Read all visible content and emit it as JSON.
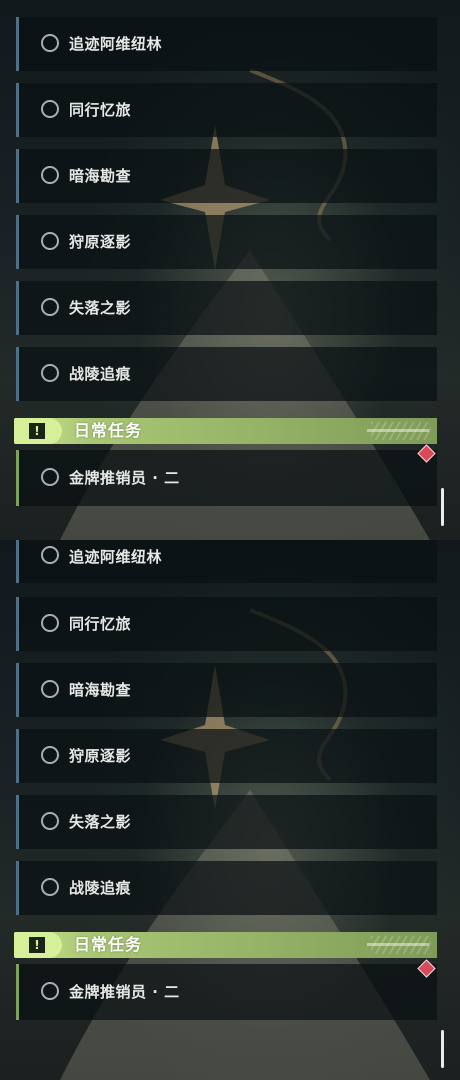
{
  "panels": [
    {
      "quests": [
        "追迹阿维纽林",
        "同行忆旅",
        "暗海勘查",
        "狩原逐影",
        "失落之影",
        "战陵追痕"
      ],
      "daily": {
        "title": "日常任务",
        "items": [
          "金牌推销员 · 二"
        ]
      }
    },
    {
      "quests": [
        "追迹阿维纽林",
        "同行忆旅",
        "暗海勘查",
        "狩原逐影",
        "失落之影",
        "战陵追痕"
      ],
      "daily": {
        "title": "日常任务",
        "items": [
          "金牌推销员 · 二"
        ]
      }
    }
  ],
  "icons": {
    "quest_status": "empty-circle-icon",
    "section": "exclamation-icon",
    "tracker_marker": "red-diamond-icon"
  },
  "colors": {
    "quest_bar": "#4f6f86",
    "daily_accent": "#a9c774",
    "marker": "#d84a5a"
  }
}
